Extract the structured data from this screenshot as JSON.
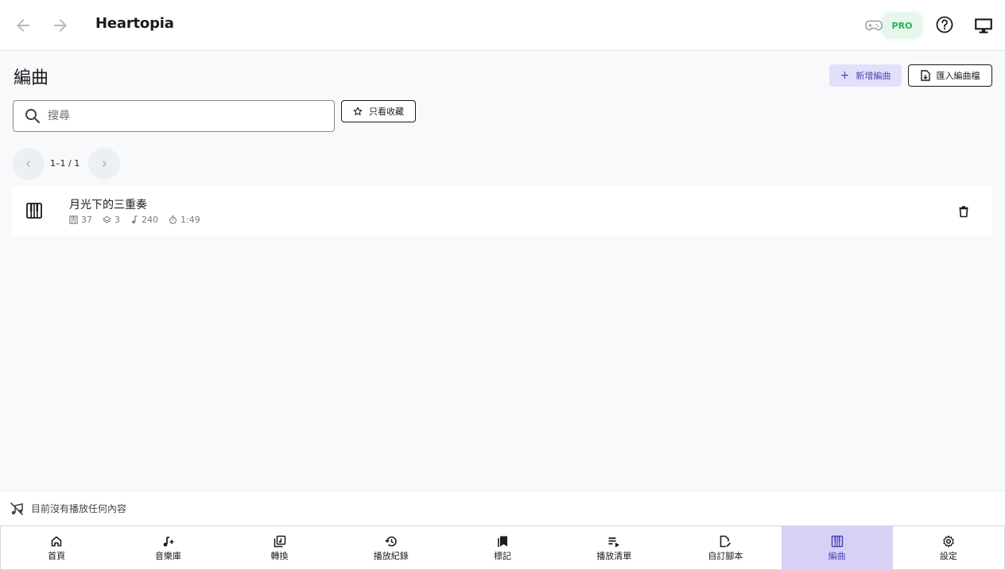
{
  "header": {
    "app_title": "Heartopia",
    "pro_badge": "PRO"
  },
  "page": {
    "title": "編曲",
    "new_button": "新增編曲",
    "import_button": "匯入編曲檔"
  },
  "search": {
    "placeholder": "搜尋",
    "value": "",
    "favorites_button": "只看收藏"
  },
  "pagination": {
    "info": "1–1 / 1"
  },
  "list": {
    "items": [
      {
        "title": "月光下的三重奏",
        "keys": "37",
        "layers": "3",
        "notes": "240",
        "duration": "1:49"
      }
    ]
  },
  "now_playing": {
    "text": "目前沒有播放任何內容"
  },
  "bottom_nav": {
    "tabs": [
      {
        "label": "首頁",
        "icon": "home-icon"
      },
      {
        "label": "音樂庫",
        "icon": "music-note-plus-icon"
      },
      {
        "label": "轉換",
        "icon": "convert-icon"
      },
      {
        "label": "播放紀錄",
        "icon": "history-icon"
      },
      {
        "label": "標記",
        "icon": "bookmarks-icon"
      },
      {
        "label": "播放清單",
        "icon": "playlist-icon"
      },
      {
        "label": "自訂腳本",
        "icon": "script-edit-icon"
      },
      {
        "label": "編曲",
        "icon": "piano-icon",
        "active": true
      },
      {
        "label": "設定",
        "icon": "gear-icon"
      }
    ]
  },
  "colors": {
    "accent": "#4d45b5",
    "accent_bg": "#d6d2f5",
    "pro_green": "#27b05a",
    "background": "#f8f9fb"
  }
}
